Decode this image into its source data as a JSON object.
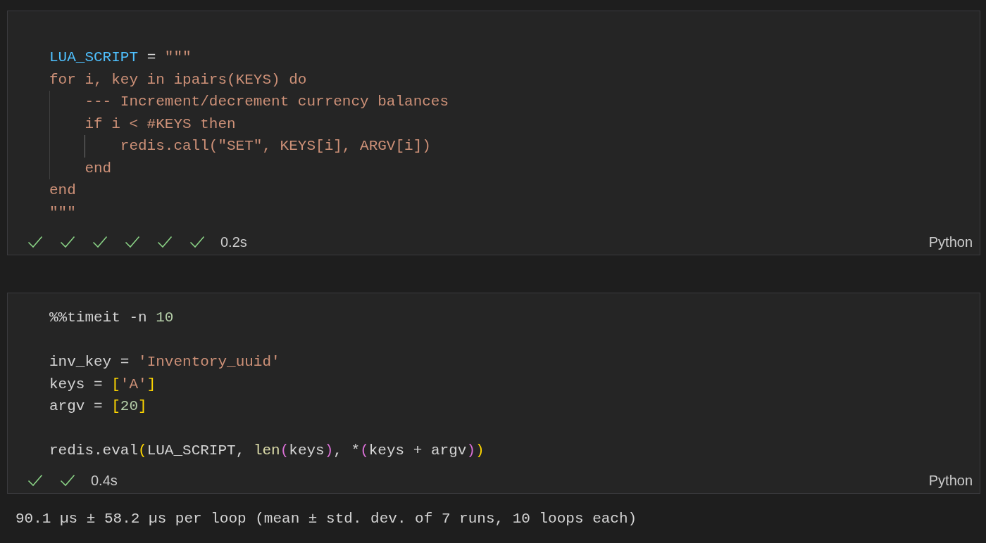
{
  "cells": [
    {
      "lines": [
        {
          "kind": "code",
          "tokens": [
            {
              "text": "LUA_SCRIPT",
              "kind": "variable"
            },
            {
              "text": " = ",
              "kind": "plain"
            },
            {
              "text": "\"\"\"",
              "kind": "string"
            }
          ]
        },
        {
          "kind": "code",
          "tokens": [
            {
              "text": "for i, key in ipairs(KEYS) do",
              "kind": "string"
            }
          ],
          "children": [
            {
              "kind": "code",
              "tokens": [
                {
                  "text": "--- Increment/decrement currency balances",
                  "kind": "string"
                }
              ]
            },
            {
              "kind": "code",
              "tokens": [
                {
                  "text": "if i < #KEYS then",
                  "kind": "string"
                }
              ],
              "children": [
                {
                  "kind": "code",
                  "tokens": [
                    {
                      "text": "redis.call(\"SET\", KEYS[i], ARGV[i])",
                      "kind": "string"
                    }
                  ]
                }
              ]
            },
            {
              "kind": "code",
              "tokens": [
                {
                  "text": "end",
                  "kind": "string"
                }
              ]
            }
          ]
        },
        {
          "kind": "code",
          "tokens": [
            {
              "text": "end",
              "kind": "string"
            }
          ]
        },
        {
          "kind": "code",
          "tokens": [
            {
              "text": "\"\"\"",
              "kind": "string"
            }
          ]
        }
      ],
      "steps": [
        {
          "passed": true
        },
        {
          "passed": true
        },
        {
          "passed": true
        },
        {
          "passed": true
        },
        {
          "passed": true
        },
        {
          "passed": true
        }
      ],
      "duration": "0.2s",
      "language": "Python"
    },
    {
      "lines": [
        {
          "kind": "code",
          "tokens": [
            {
              "text": "%%timeit -n ",
              "kind": "plain"
            },
            {
              "text": "10",
              "kind": "number"
            }
          ]
        },
        {
          "kind": "blank"
        },
        {
          "kind": "code",
          "tokens": [
            {
              "text": "inv_key = ",
              "kind": "plain"
            },
            {
              "text": "'Inventory_uuid'",
              "kind": "string"
            }
          ]
        },
        {
          "kind": "code",
          "tokens": [
            {
              "text": "keys = ",
              "kind": "plain"
            },
            {
              "text": "[",
              "kind": "bracket1"
            },
            {
              "text": "'A'",
              "kind": "string"
            },
            {
              "text": "]",
              "kind": "bracket1"
            }
          ]
        },
        {
          "kind": "code",
          "tokens": [
            {
              "text": "argv = ",
              "kind": "plain"
            },
            {
              "text": "[",
              "kind": "bracket1"
            },
            {
              "text": "20",
              "kind": "number"
            },
            {
              "text": "]",
              "kind": "bracket1"
            }
          ]
        },
        {
          "kind": "blank"
        },
        {
          "kind": "code",
          "tokens": [
            {
              "text": "redis.eval",
              "kind": "plain"
            },
            {
              "text": "(",
              "kind": "bracket1"
            },
            {
              "text": "LUA_SCRIPT, ",
              "kind": "plain"
            },
            {
              "text": "len",
              "kind": "function"
            },
            {
              "text": "(",
              "kind": "bracket2"
            },
            {
              "text": "keys",
              "kind": "plain"
            },
            {
              "text": ")",
              "kind": "bracket2"
            },
            {
              "text": ", *",
              "kind": "plain"
            },
            {
              "text": "(",
              "kind": "bracket2"
            },
            {
              "text": "keys + argv",
              "kind": "plain"
            },
            {
              "text": ")",
              "kind": "bracket2"
            },
            {
              "text": ")",
              "kind": "bracket1"
            }
          ]
        }
      ],
      "steps": [
        {
          "passed": true
        },
        {
          "passed": true
        }
      ],
      "duration": "0.4s",
      "language": "Python",
      "output": "90.1 µs ± 58.2 µs per loop (mean ± std. dev. of 7 runs, 10 loops each)"
    }
  ]
}
